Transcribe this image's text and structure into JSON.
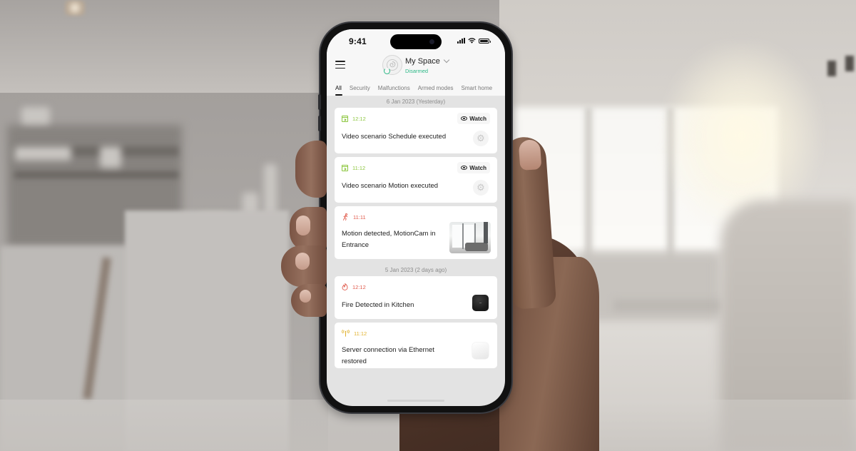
{
  "status_bar": {
    "time": "9:41",
    "signal_icon": "cellular-signal-icon",
    "wifi_icon": "wifi-icon",
    "battery_icon": "battery-icon"
  },
  "header": {
    "menu_icon": "hamburger-menu-icon",
    "space_name": "My Space",
    "space_status": "Disarmed",
    "status_color": "#2bb886",
    "dropdown_icon": "chevron-down-icon"
  },
  "tabs": [
    {
      "label": "All",
      "active": true
    },
    {
      "label": "Security",
      "active": false
    },
    {
      "label": "Malfunctions",
      "active": false
    },
    {
      "label": "Armed modes",
      "active": false
    },
    {
      "label": "Smart home",
      "active": false
    }
  ],
  "feed": {
    "groups": [
      {
        "date": "6 Jan 2023 (Yesterday)",
        "events": [
          {
            "time": "12:12",
            "title": "Video scenario Schedule executed",
            "icon": "video-scenario-icon",
            "color": "#8cc63f",
            "action": "Watch",
            "thumbnail": "scenario-gear-icon"
          },
          {
            "time": "11:12",
            "title": "Video scenario Motion executed",
            "icon": "video-scenario-icon",
            "color": "#8cc63f",
            "action": "Watch",
            "thumbnail": "scenario-gear-icon"
          },
          {
            "time": "11:11",
            "title": "Motion detected, MotionCam in Entrance",
            "icon": "motion-icon",
            "color": "#e05a4b",
            "thumbnail": "camera-snapshot"
          }
        ]
      },
      {
        "date": "5 Jan 2023 (2 days ago)",
        "events": [
          {
            "time": "12:12",
            "title": "Fire Detected in Kitchen",
            "icon": "fire-icon",
            "color": "#e05a4b",
            "thumbnail": "hub-device-black"
          },
          {
            "time": "11:12",
            "title": "Server connection via Ethernet restored",
            "icon": "ethernet-icon",
            "color": "#e1b12c",
            "thumbnail": "hub-device-white"
          }
        ]
      }
    ]
  },
  "glyphs": {
    "gear": "⚙",
    "motion": "🏃",
    "fire": "♨",
    "ethernet": "ᛘ"
  }
}
